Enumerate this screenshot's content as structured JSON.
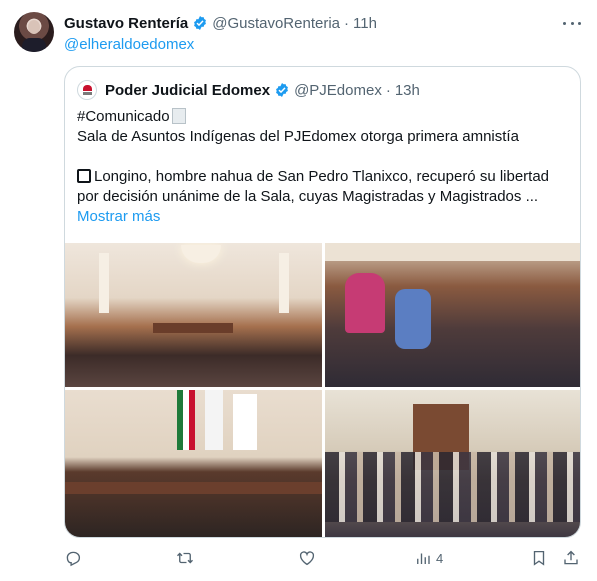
{
  "tweet": {
    "author_name": "Gustavo Rentería",
    "author_handle": "@GustavoRenteria",
    "time": "11h",
    "dot": "·",
    "text": "@elheraldoedomex"
  },
  "quoted": {
    "author_name": "Poder Judicial Edomex",
    "author_handle": "@PJEdomex",
    "time": "13h",
    "dot": "·",
    "line1": "#Comunicado",
    "line2": "Sala de Asuntos Indígenas del PJEdomex otorga primera amnistía",
    "line3": "Longino, hombre nahua de San Pedro Tlanixco, recuperó su libertad",
    "line4": "por decisión unánime de la Sala, cuyas Magistradas y Magistrados ...",
    "show_more": "Mostrar más"
  },
  "actions": {
    "views_count": "4"
  },
  "colors": {
    "link": "#1d9bf0",
    "muted": "#536471",
    "border": "#cfd9de"
  },
  "icons": [
    "verified-badge-icon",
    "more-options-icon",
    "reply-icon",
    "retweet-icon",
    "like-icon",
    "views-icon",
    "bookmark-icon",
    "share-icon"
  ]
}
